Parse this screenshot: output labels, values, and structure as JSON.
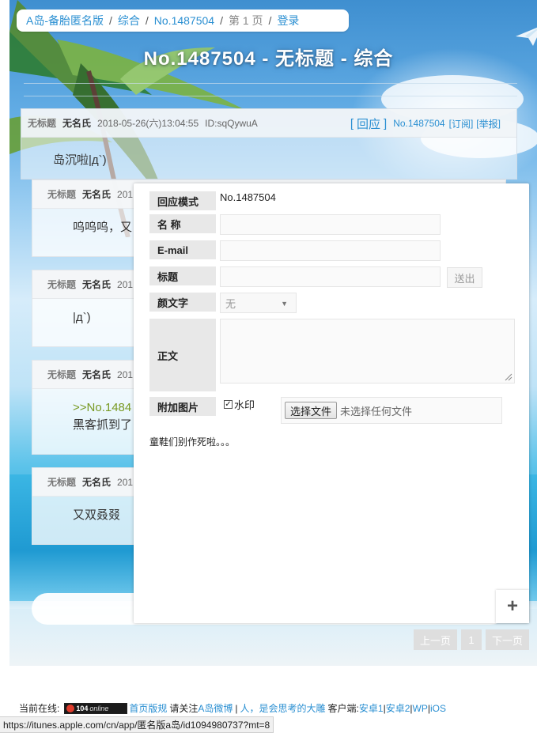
{
  "breadcrumb": {
    "site": "A岛-备胎匿名版",
    "sep": "/",
    "board": "综合",
    "thread": "No.1487504",
    "page": "第 1 页",
    "login": "登录"
  },
  "thread_title": "No.1487504 - 无标题 - 综合",
  "main_post": {
    "title": "无标题",
    "name": "无名氏",
    "date": "2018-05-26(六)13:04:55",
    "uid": "ID:sqQywuA",
    "reply_label": "回应",
    "post_no": "No.1487504",
    "subscribe": "订阅",
    "report": "举报",
    "content": "岛沉啦|д`)"
  },
  "replies": [
    {
      "title": "无标题",
      "name": "无名氏",
      "date_visible": "201",
      "content": "呜呜呜，又"
    },
    {
      "title": "无标题",
      "name": "无名氏",
      "date_visible": "201",
      "content": "|д`)"
    },
    {
      "title": "无标题",
      "name": "无名氏",
      "date_visible": "201",
      "quote": ">>No.1484",
      "content": "黑客抓到了"
    },
    {
      "title": "无标题",
      "name": "无名氏",
      "date_visible": "201",
      "content": "又双叒叕"
    }
  ],
  "reply_form": {
    "mode_label": "回应模式",
    "mode_value": "No.1487504",
    "name_label": "名 称",
    "email_label": "E-mail",
    "subject_label": "标题",
    "send_button": "送出",
    "emoticon_label": "颜文字",
    "emoticon_value": "无",
    "body_label": "正文",
    "image_label": "附加图片",
    "watermark_checked": true,
    "watermark_label": "水印",
    "choose_file_button": "选择文件",
    "no_file_text": "未选择任何文件",
    "note": "童鞋们别作死啦。。。"
  },
  "pagination": {
    "prev": "上一页",
    "current": "1",
    "next": "下一页"
  },
  "footer": {
    "online_prefix": "当前在线:",
    "online_count": "104",
    "online_badge_text": "online",
    "homepage_rules": "首页版规",
    "follow_text": "请关注",
    "weibo_link": "A岛微博",
    "bar": "|",
    "slogan_link": "人，是会思考的大雕",
    "client_text": "客户端:",
    "android1": "安卓1",
    "android2": "安卓2",
    "wp": "WP",
    "ios": "iOS"
  },
  "status_url": "https://itunes.apple.com/cn/app/匿名版a岛/id1094980737?mt=8",
  "colors": {
    "link": "#2a8fd2",
    "quote": "#789922",
    "pager_bg": "#dedede"
  },
  "icons": [
    "paper-plane-icon",
    "plus-icon",
    "dropdown-arrow-icon",
    "checkbox-icon",
    "resize-grip-icon"
  ]
}
